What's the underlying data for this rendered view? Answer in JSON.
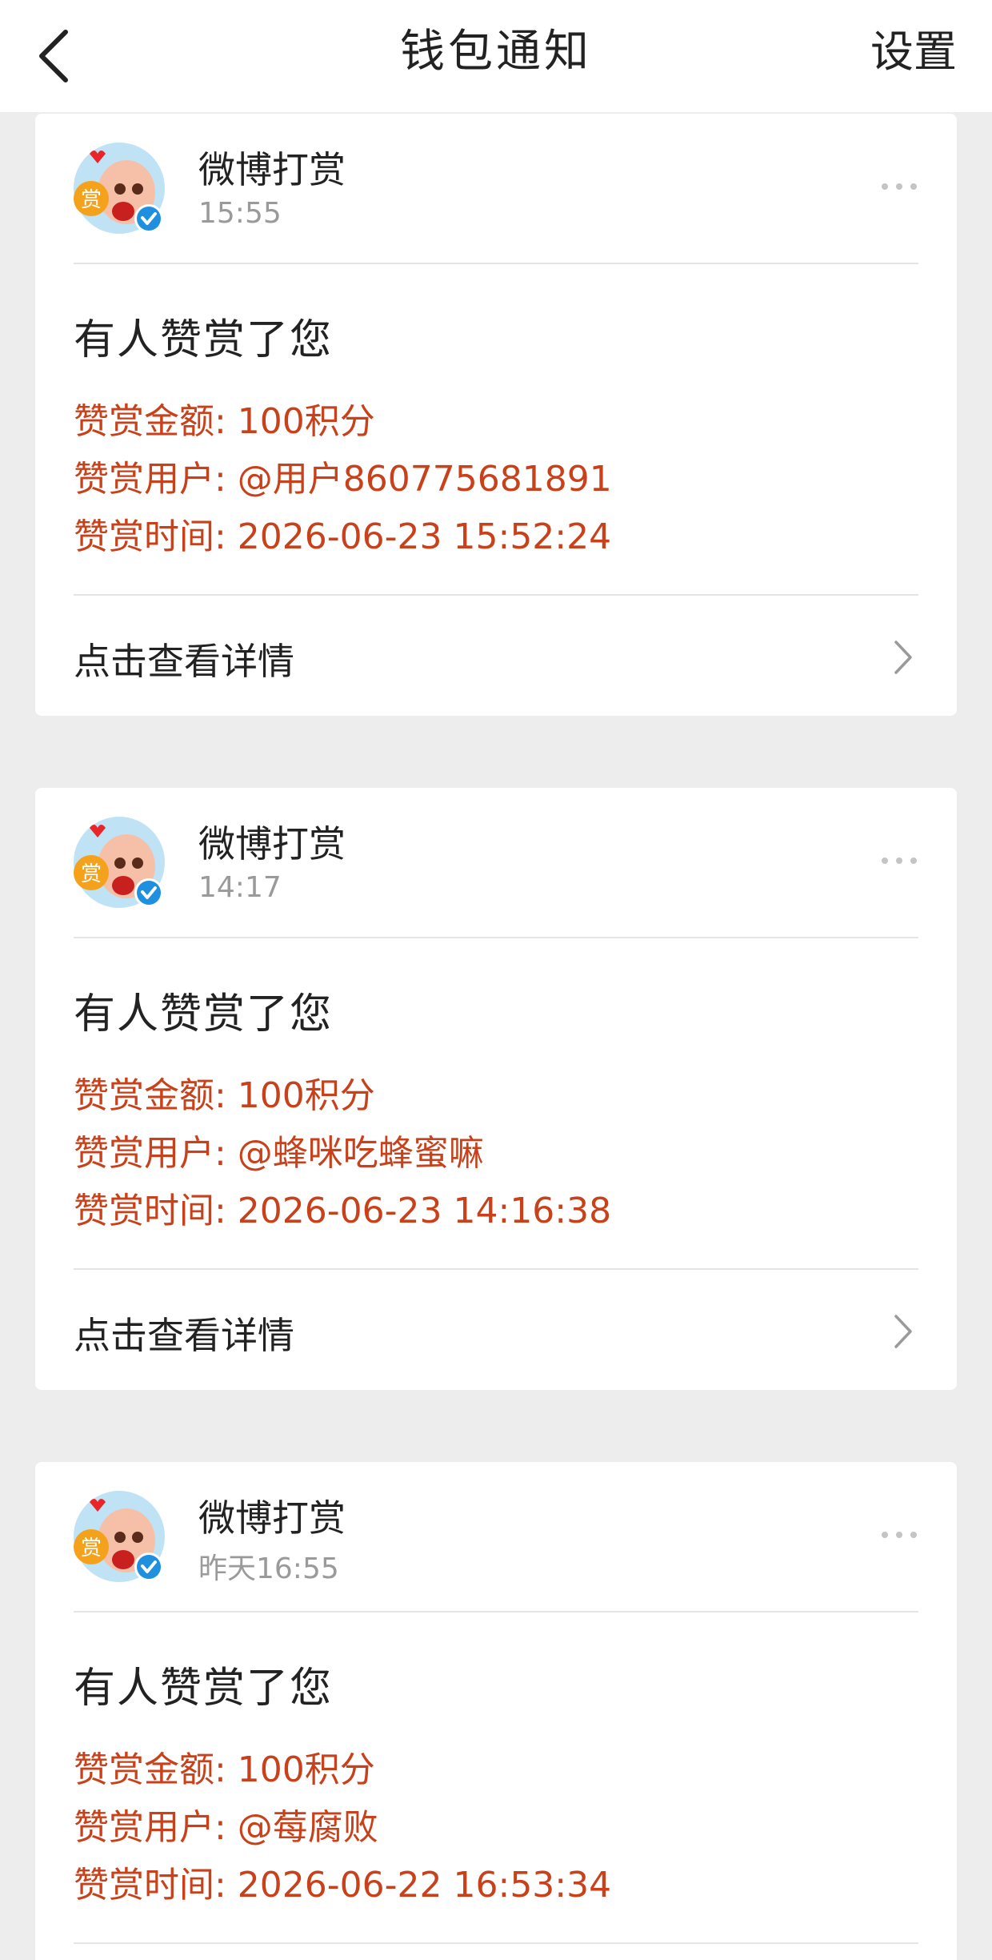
{
  "header": {
    "title": "钱包通知",
    "settings_label": "设置",
    "back_icon": "back-arrow-icon"
  },
  "colors": {
    "accent_text": "#c8411a",
    "background": "#ededed",
    "card": "#ffffff"
  },
  "avatar_badge_glyph": "赏",
  "notifications": [
    {
      "sender": "微博打赏",
      "time": "15:55",
      "title": "有人赞赏了您",
      "amount": "赞赏金额: 100积分",
      "user": "赞赏用户: @用户860775681891",
      "reward_time": "赞赏时间: 2026-06-23 15:52:24",
      "link_label": "点击查看详情"
    },
    {
      "sender": "微博打赏",
      "time": "14:17",
      "title": "有人赞赏了您",
      "amount": "赞赏金额: 100积分",
      "user": "赞赏用户: @蜂咪吃蜂蜜嘛",
      "reward_time": "赞赏时间: 2026-06-23 14:16:38",
      "link_label": "点击查看详情"
    },
    {
      "sender": "微博打赏",
      "time": "昨天16:55",
      "title": "有人赞赏了您",
      "amount": "赞赏金额: 100积分",
      "user": "赞赏用户: @莓腐败",
      "reward_time": "赞赏时间: 2026-06-22 16:53:34"
    }
  ]
}
